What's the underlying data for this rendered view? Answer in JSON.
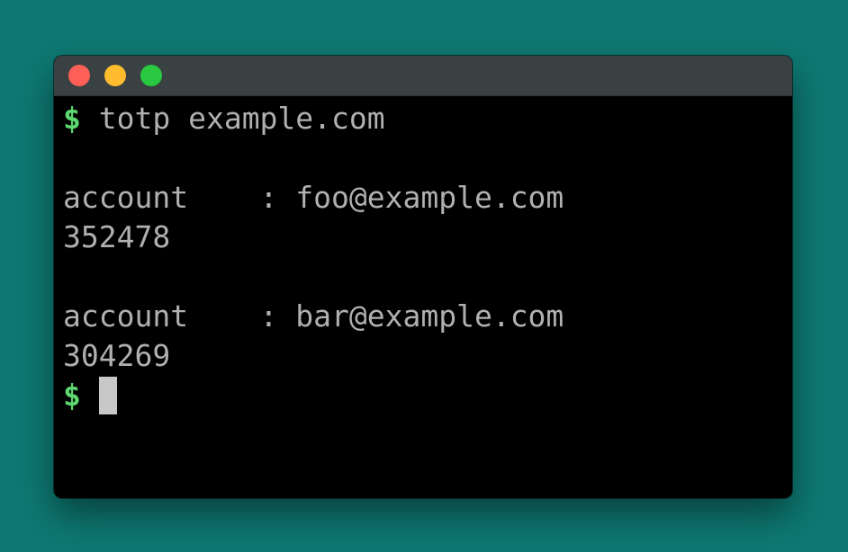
{
  "window": {
    "controls": {
      "close_color": "#fe5f57",
      "minimize_color": "#febc2e",
      "maximize_color": "#28c840"
    }
  },
  "terminal": {
    "prompt_symbol": "$",
    "command": "totp example.com",
    "entries": [
      {
        "label": "account    : ",
        "account": "foo@example.com",
        "code": "352478"
      },
      {
        "label": "account    : ",
        "account": "bar@example.com",
        "code": "304269"
      }
    ],
    "colors": {
      "background": "#000000",
      "text": "#b0b0b0",
      "prompt": "#5cd66f",
      "desktop": "#0e7872"
    }
  }
}
